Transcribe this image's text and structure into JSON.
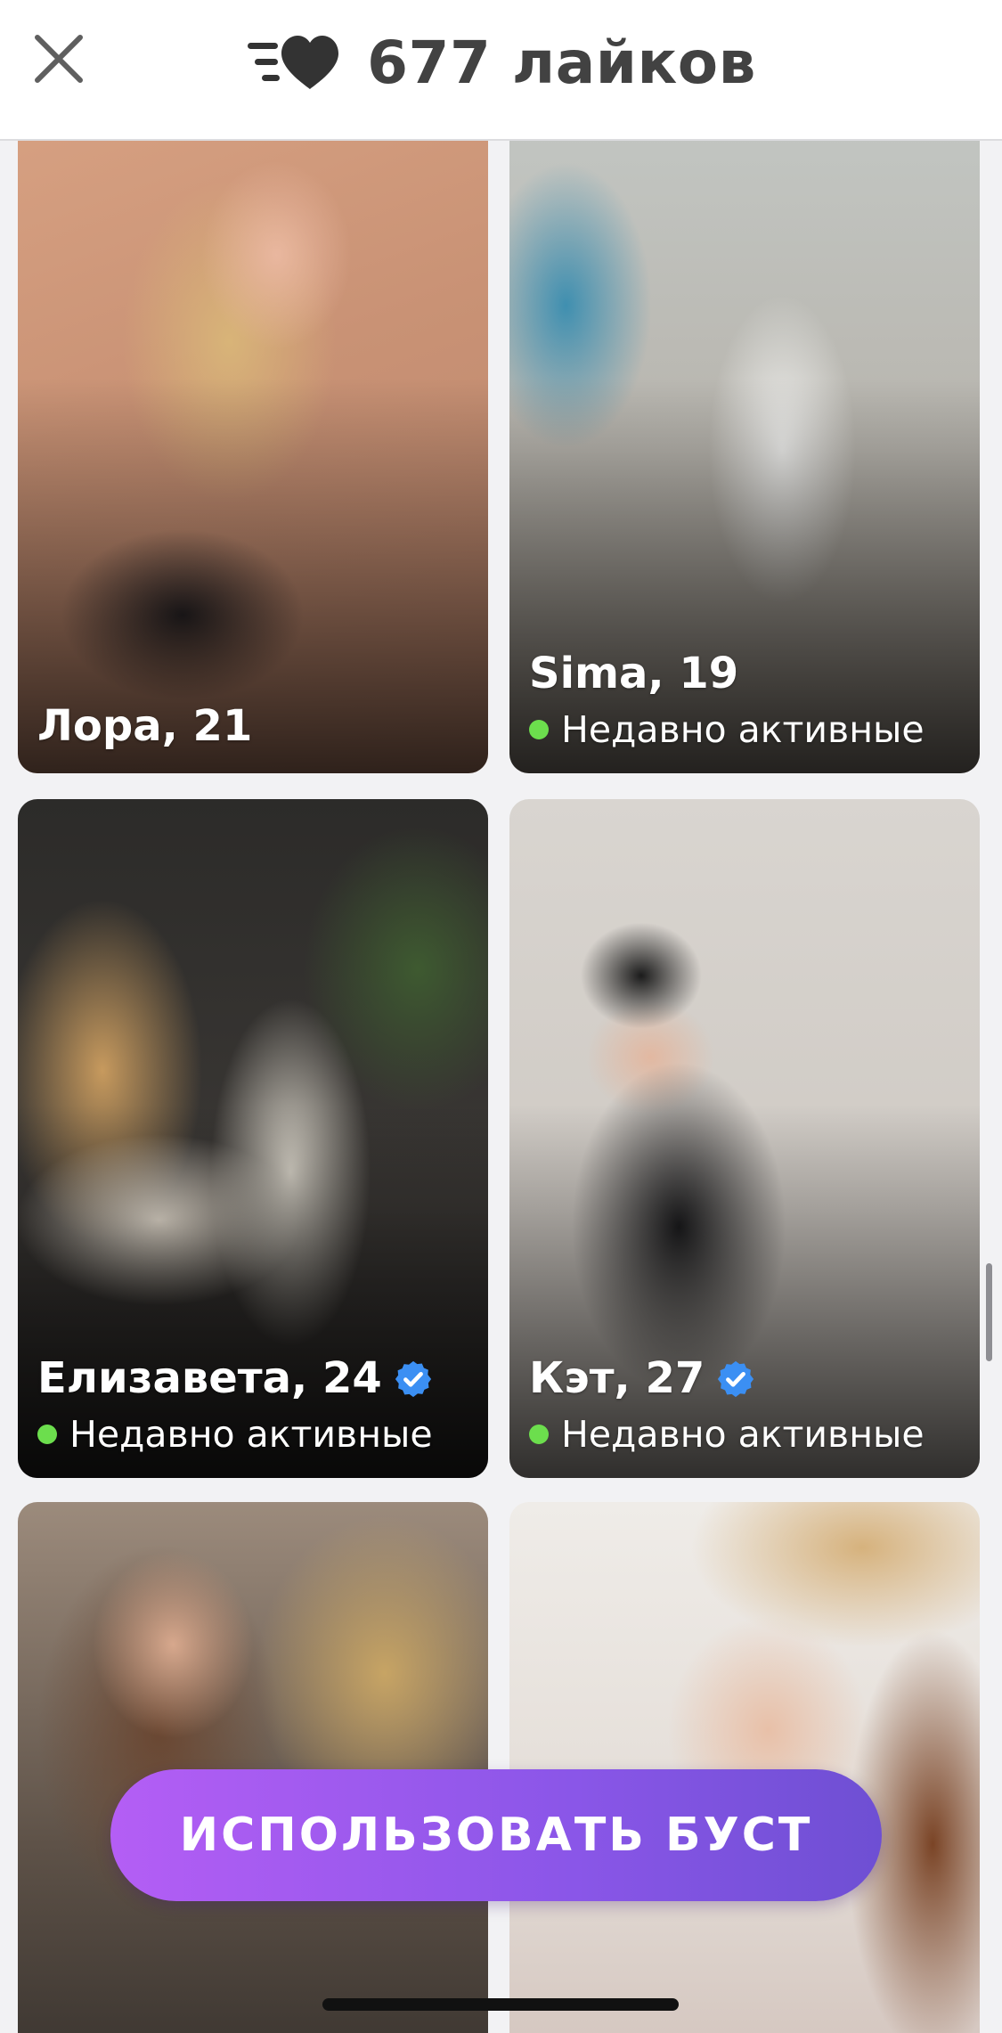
{
  "header": {
    "title": "677 лайков",
    "close_icon": "close-icon",
    "likes_icon": "heart-speed-icon"
  },
  "cards": [
    {
      "name_age": "Лора, 21",
      "verified": false,
      "status": ""
    },
    {
      "name_age": "Sima, 19",
      "verified": false,
      "status": "Недавно активные"
    },
    {
      "name_age": "Елизавета, 24",
      "verified": true,
      "status": "Недавно активные"
    },
    {
      "name_age": "Кэт, 27",
      "verified": true,
      "status": "Недавно активные"
    },
    {
      "name_age": "",
      "verified": false,
      "status": ""
    },
    {
      "name_age": "",
      "verified": false,
      "status": ""
    }
  ],
  "boost": {
    "label": "ИСПОЛЬЗОВАТЬ БУСТ"
  },
  "colors": {
    "online_dot": "#6cde4d",
    "verified_badge": "#3b8ff3",
    "boost_start": "#b45ef5",
    "boost_end": "#6e4fd3",
    "header_text": "#424242"
  }
}
